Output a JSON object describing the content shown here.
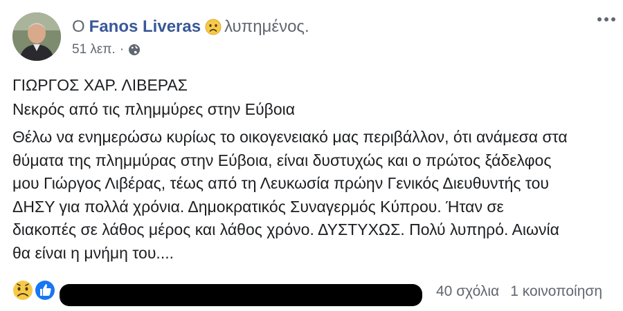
{
  "header": {
    "prefix": "Ο",
    "author": "Fanos Liveras",
    "feeling_icon": "sad-face-emoji",
    "feeling_text": "λυπημένος.",
    "time": "51 λεπ.",
    "separator": "·",
    "audience_icon": "globe-icon",
    "menu_icon": "more-options-icon"
  },
  "post": {
    "line1": "ΓΙΩΡΓΟΣ ΧΑΡ. ΛΙΒΕΡΑΣ",
    "line2": "Νεκρός από τις πλημμύρες στην Εύβοια",
    "paragraph_lines": [
      "Θέλω να ενημερώσω κυρίως το οικογενειακό μας περιβάλλον, ότι ανάμεσα στα",
      "θύματα της πλημμύρας στην Εύβοια, είναι δυστυχώς και ο πρώτος ξάδελφος",
      "μου Γιώργος Λιβέρας, τέως από τη Λευκωσία πρώην Γενικός Διευθυντής του",
      "ΔΗΣΥ για πολλά χρόνια. Δημοκρατικός Συναγερμός Κύπρου. Ήταν σε",
      "διακοπές σε λάθος μέρος και λάθος χρόνο. ΔΥΣΤΥΧΩΣ. Πολύ λυπηρό. Αιωνία",
      "θα είναι η μνήμη του...."
    ]
  },
  "footer": {
    "reaction_icons": [
      "sad-reaction-icon",
      "like-reaction-icon"
    ],
    "comments": "40 σχόλια",
    "shares": "1 κοινοποίηση"
  },
  "colors": {
    "author_link": "#385898",
    "meta_text": "#606770",
    "body_text": "#1c1e21",
    "like_blue": "#1877f2",
    "emoji_yellow": "#f7c948"
  }
}
